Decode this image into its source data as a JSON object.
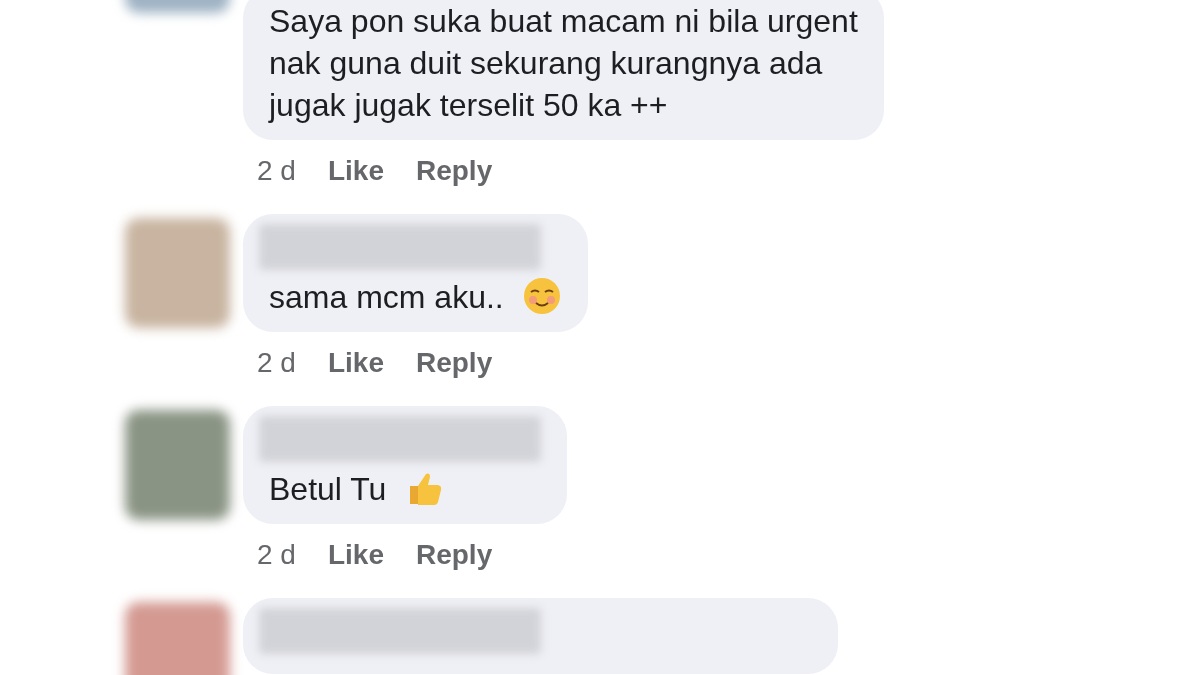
{
  "comments": [
    {
      "kind": "plain",
      "lines": [
        "Saya pon suka buat macam ni bila urgent",
        "nak guna duit sekurang kurangnya ada",
        "jugak jugak terselit 50 ka ++"
      ],
      "time": "2 d",
      "actions": [
        "Like",
        "Reply"
      ]
    },
    {
      "kind": "smiley",
      "name_hidden": true,
      "lines": [
        "sama mcm aku.."
      ],
      "time": "2 d",
      "actions": [
        "Like",
        "Reply"
      ]
    },
    {
      "kind": "thumbsup",
      "name_hidden": true,
      "lines": [
        "Betul Tu"
      ],
      "time": "2 d",
      "actions": [
        "Like",
        "Reply"
      ]
    },
    {
      "name_hidden": true
    }
  ]
}
